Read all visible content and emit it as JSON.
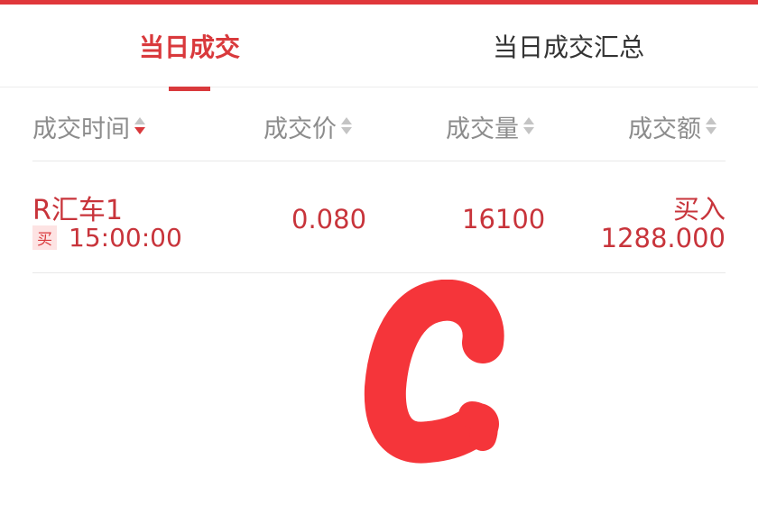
{
  "tabs": [
    {
      "label": "当日成交",
      "active": true
    },
    {
      "label": "当日成交汇总",
      "active": false
    }
  ],
  "columns": {
    "time": "成交时间",
    "price": "成交价",
    "volume": "成交量",
    "amount": "成交额"
  },
  "rows": [
    {
      "name": "R汇车1",
      "side_badge": "买",
      "time": "15:00:00",
      "price": "0.080",
      "volume": "16100",
      "side": "买入",
      "amount": "1288.000"
    }
  ],
  "colors": {
    "accent": "#d9393c",
    "text_red": "#c8343b",
    "header_gray": "#8c8c8c",
    "scribble": "#f5353a"
  },
  "icons": [
    "sort-icon"
  ]
}
